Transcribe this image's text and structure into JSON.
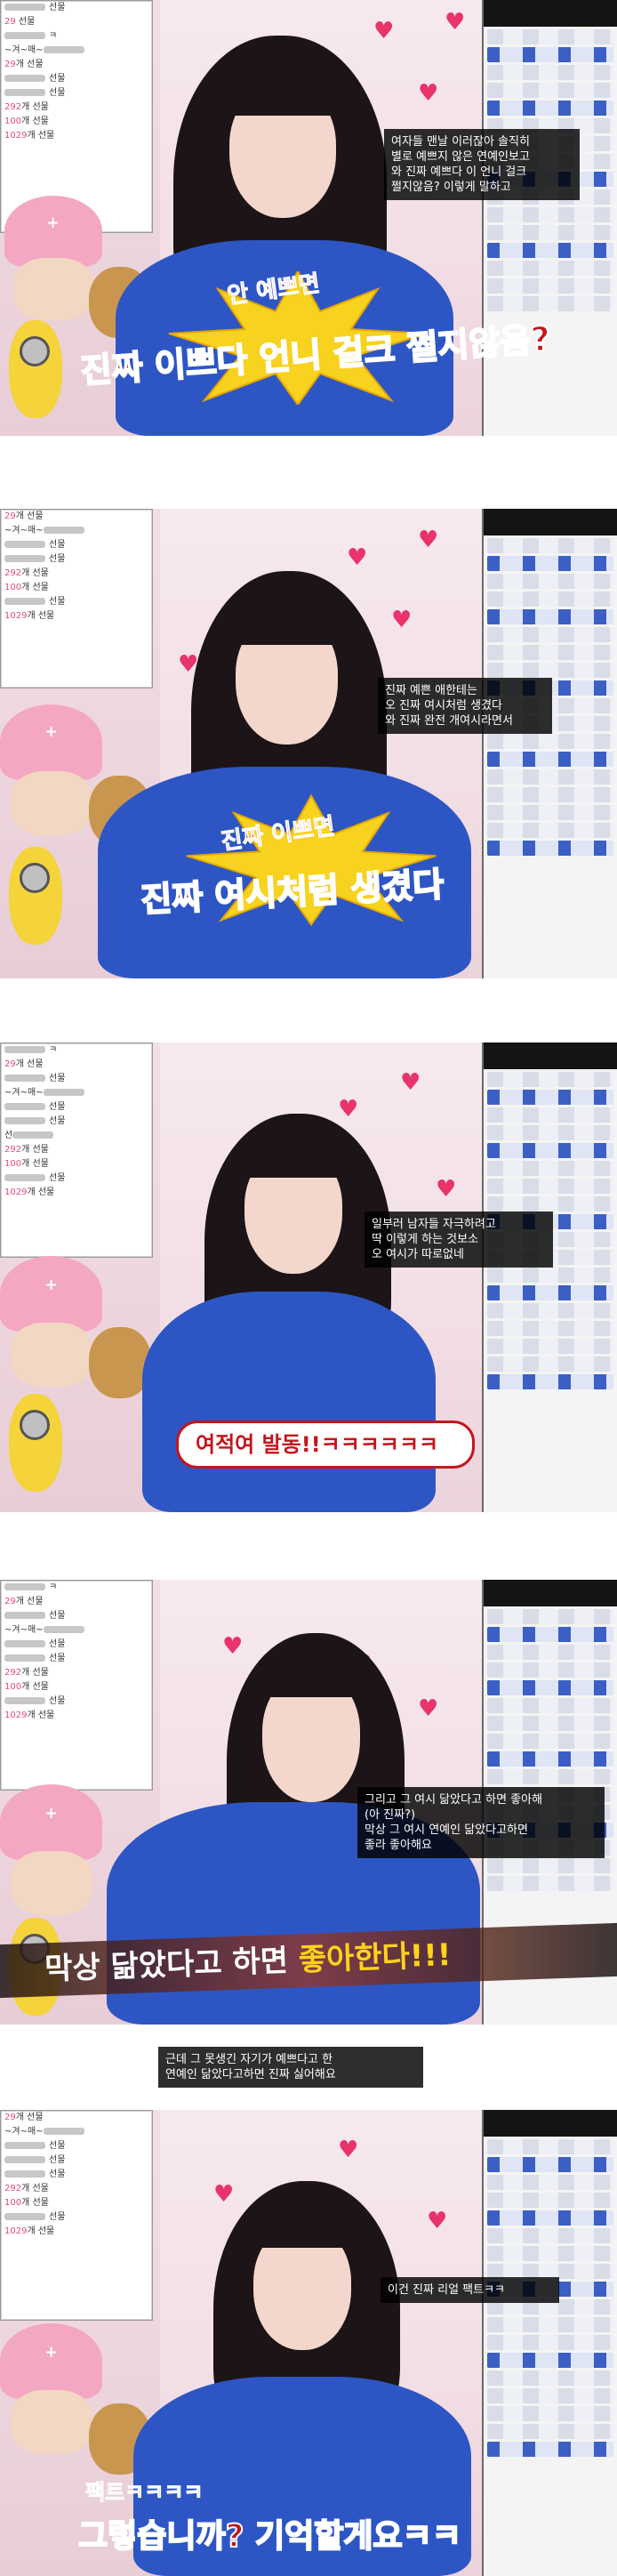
{
  "panels": [
    {
      "caption": "여자들 맨날 이러잖아 솔직히\n별로 예쁘지 않은 연예인보고\n와 진짜 예쁘다 이 언니 걸크\n쩔지않음? 이렇게 말하고",
      "title_small": "안 예쁘면",
      "title_big": "진짜 이쁘다 언니 걸크 쩔지않음?"
    },
    {
      "caption": "진짜 예쁜 애한테는\n오 진짜 여시처럼 생겼다\n와 진짜 완전 개여시라면서",
      "title_small": "진짜 이쁘면",
      "title_big": "진짜 여시처럼 생겼다"
    },
    {
      "caption": "일부러 남자들 자극하려고\n딱 이렇게 하는 것보소\n오 여시가 따로없네",
      "title_big": "여적여 발동!!ㅋㅋㅋㅋㅋㅋ"
    },
    {
      "caption": "그리고 그 여시 닮았다고 하면 좋아해\n(아 진짜?)\n막상 그 여시 연예인 닮았다고하면\n좋라 좋아해요",
      "title_big_a": "막상 닮았다고 하면 ",
      "title_big_b": "좋아한다!!!"
    },
    {
      "caption_top": "근데 그 못생긴 자기가 예쁘다고 한\n연예인 닮았다고하면 진짜 싫어해요",
      "caption": "이건 진짜 리얼 팩트ㅋㅋ",
      "title_small": "팩트ㅋㅋㅋㅋ",
      "title_big": "그렇습니까? 기억할게요ㅋㅋ"
    }
  ]
}
